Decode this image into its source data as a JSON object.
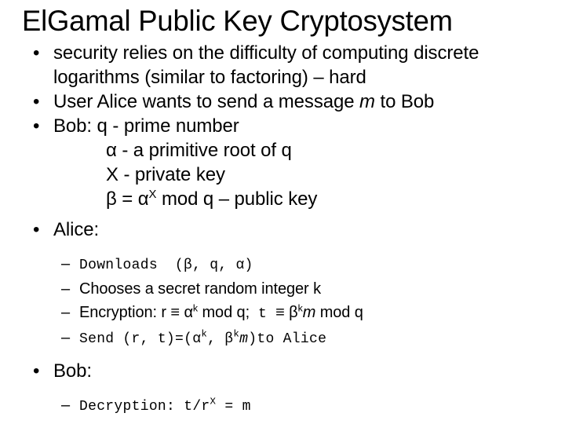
{
  "slide": {
    "title": "ElGamal Public Key Cryptosystem",
    "background_color": "#ffffff",
    "text_color": "#000000",
    "bullet_glyph": "•",
    "dash_glyph": "–",
    "bullets": [
      {
        "line1": "security relies on the difficulty of computing discrete",
        "line2": "logarithms (similar to factoring) – hard"
      },
      {
        "pre_m": "User Alice wants to send a message ",
        "m": "m",
        "post_m": " to Bob"
      },
      {
        "text": "Bob: q - prime number"
      }
    ],
    "bob_params": [
      {
        "text": "α - a primitive root of q"
      },
      {
        "text": "X - private key"
      }
    ],
    "public_key_line": {
      "lead": "β = α",
      "exponent": "X",
      "tail": " mod q – public key"
    },
    "alice_heading": "Alice:",
    "alice_steps": [
      {
        "kind": "mono",
        "text": "Downloads",
        "paren_open": "(β,",
        "q": "q,",
        "alpha": "α)"
      },
      {
        "kind": "sans",
        "text": "Chooses a secret random integer k"
      },
      {
        "kind": "mixed",
        "label": "Encryption: r ≡ α",
        "exp1": "k",
        "mid": " mod q;",
        "t": "t",
        "equiv": "≡ β",
        "exp2": "k",
        "m": "m",
        "tail": " mod q"
      },
      {
        "kind": "mono-send",
        "send": "Send",
        "args": "(r, t)=(α",
        "exp1": "k",
        "comma": ",  β",
        "exp2": "k",
        "m": "m",
        "close": ")",
        "to": "to Alice"
      }
    ],
    "bob_heading": "Bob:",
    "bob_steps": [
      {
        "kind": "mono",
        "label": "Decryption: t/r",
        "exponent": "X",
        "tail": " = m"
      }
    ]
  }
}
